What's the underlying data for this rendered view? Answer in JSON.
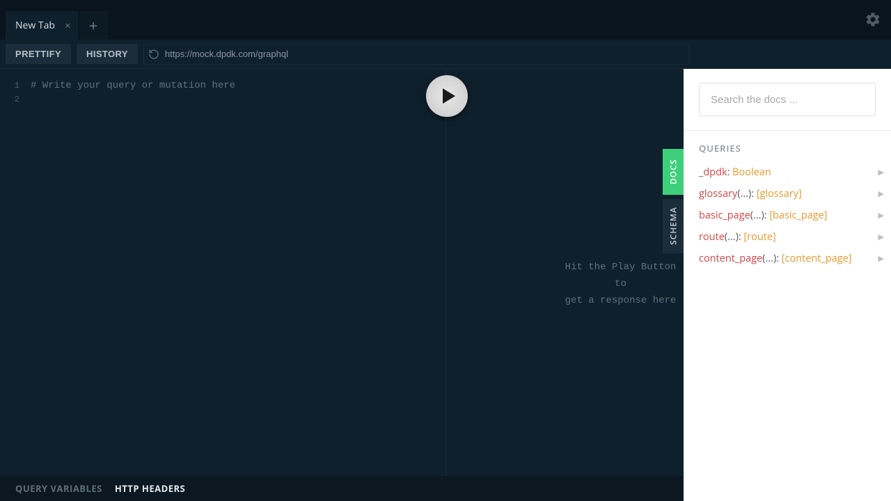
{
  "topbar": {
    "tab_title": "New Tab",
    "close_glyph": "×",
    "add_glyph": "+"
  },
  "toolbar": {
    "prettify_label": "PRETTIFY",
    "history_label": "HISTORY",
    "url_value": "https://mock.dpdk.com/graphql"
  },
  "editor": {
    "lines": [
      "1",
      "2"
    ],
    "placeholder": "# Write your query or mutation here"
  },
  "response": {
    "hint_line1": "Hit the Play Button to",
    "hint_line2": "get a response here"
  },
  "sidetabs": {
    "docs_label": "DOCS",
    "schema_label": "SCHEMA"
  },
  "docs": {
    "search_placeholder": "Search the docs ...",
    "queries_header": "QUERIES",
    "queries": [
      {
        "name": "_dpdk",
        "args": "",
        "type": "Boolean",
        "bracket": false
      },
      {
        "name": "glossary",
        "args": "(...)",
        "type": "[glossary]",
        "bracket": true
      },
      {
        "name": "basic_page",
        "args": "(...)",
        "type": "[basic_page]",
        "bracket": true
      },
      {
        "name": "route",
        "args": "(...)",
        "type": "[route]",
        "bracket": true
      },
      {
        "name": "content_page",
        "args": "(...)",
        "type": "[content_page]",
        "bracket": true
      }
    ]
  },
  "bottombar": {
    "query_vars_label": "QUERY VARIABLES",
    "http_headers_label": "HTTP HEADERS"
  }
}
